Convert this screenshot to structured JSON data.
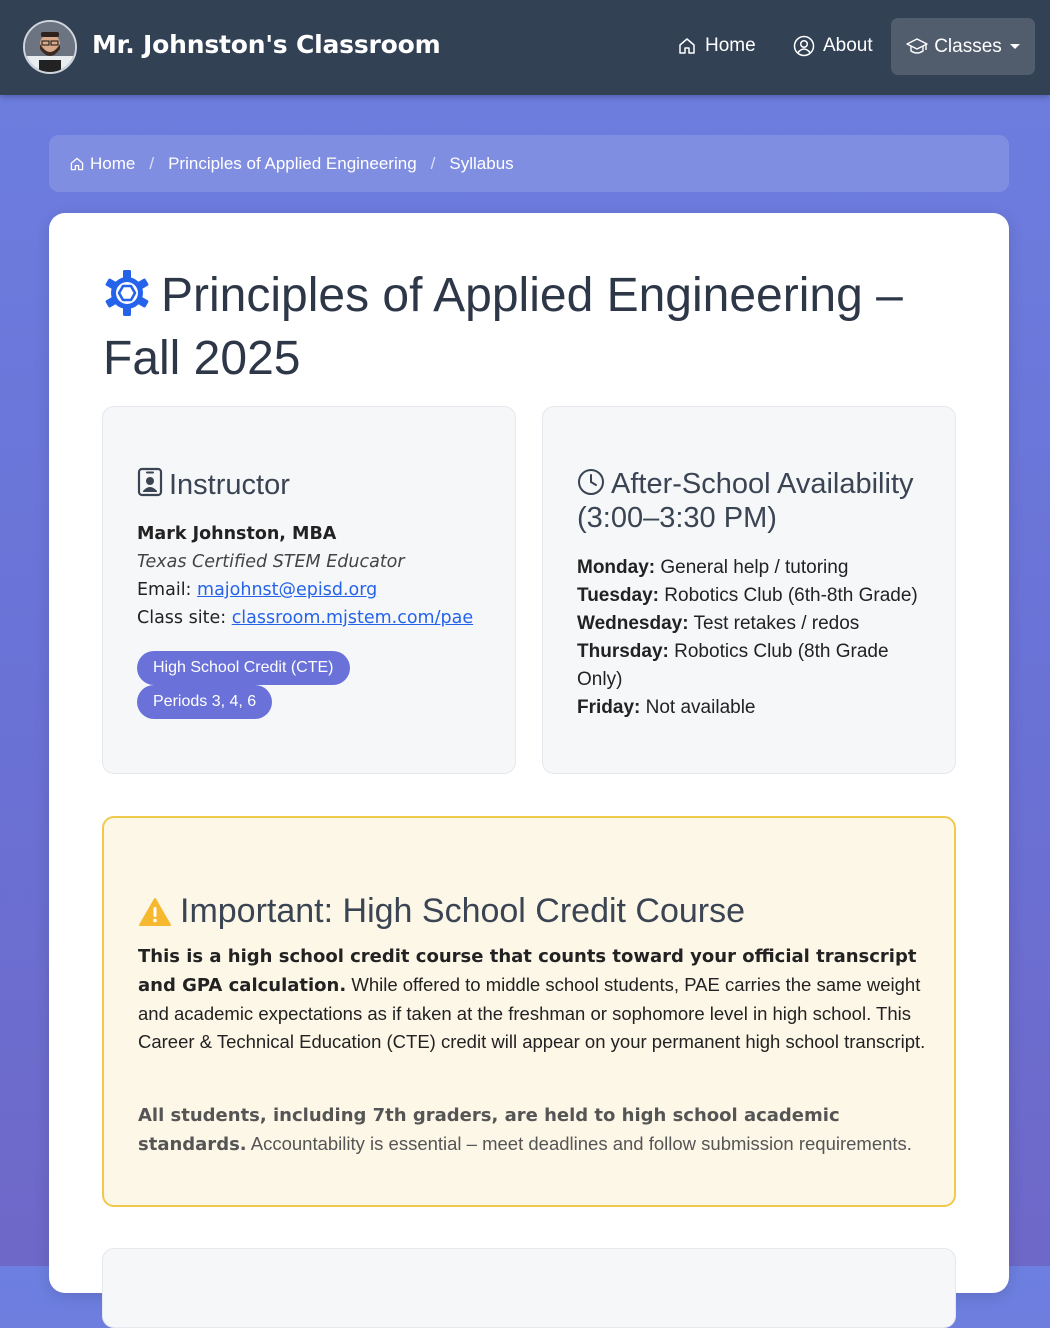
{
  "header": {
    "brand": "Mr. Johnston's Classroom",
    "nav": {
      "home": "Home",
      "about": "About",
      "classes": "Classes"
    }
  },
  "breadcrumb": {
    "home": "Home",
    "course": "Principles of Applied Engineering",
    "current": "Syllabus"
  },
  "page": {
    "title": "Principles of Applied Engineering – Fall 2025"
  },
  "instructor": {
    "heading": "Instructor",
    "name": "Mark Johnston, MBA",
    "credential": "Texas Certified STEM Educator",
    "email_label": "Email:",
    "email": "majohnst@episd.org",
    "site_label": "Class site:",
    "site": "classroom.mjstem.com/pae",
    "badges": [
      "High School Credit (CTE)",
      "Periods 3, 4, 6"
    ]
  },
  "availability": {
    "heading": "After-School Availability (3:00–3:30 PM)",
    "days": [
      {
        "day": "Monday:",
        "text": "General help / tutoring"
      },
      {
        "day": "Tuesday:",
        "text": "Robotics Club (6th-8th Grade)"
      },
      {
        "day": "Wednesday:",
        "text": "Test retakes / redos"
      },
      {
        "day": "Thursday:",
        "text": "Robotics Club (8th Grade Only)"
      },
      {
        "day": "Friday:",
        "text": "Not available"
      }
    ]
  },
  "alert": {
    "heading": "Important: High School Credit Course",
    "p1_bold": "This is a high school credit course that counts toward your official transcript and GPA calculation.",
    "p1_text": " While offered to middle school students, PAE carries the same weight and academic expectations as if taken at the freshman or sophomore level in high school. This Career & Technical Education (CTE) credit will appear on your permanent high school transcript.",
    "p2_bold": "All students, including 7th graders, are held to high school academic standards.",
    "p2_text": " Accountability is essential – meet deadlines and follow submission requirements.",
    "accent_color": "#f0c94b"
  },
  "colors": {
    "navbar": "#334155",
    "accent": "#6a72da",
    "link": "#2563eb",
    "gear_icon": "#2563eb"
  }
}
